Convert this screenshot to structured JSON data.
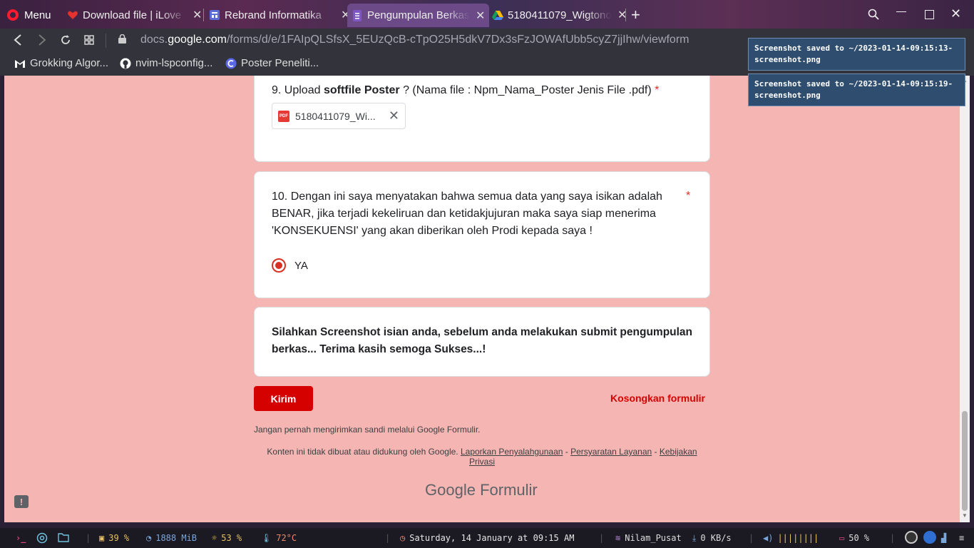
{
  "browser": {
    "menu_label": "Menu",
    "tabs": [
      {
        "title": "Download file | iLove",
        "icon": "heart-icon"
      },
      {
        "title": "Rebrand Informatika",
        "icon": "forms-icon"
      },
      {
        "title": "Pengumpulan Berkas",
        "icon": "forms-icon"
      },
      {
        "title": "5180411079_Wigtono",
        "icon": "drive-icon"
      }
    ],
    "url_prefix": "docs.",
    "url_host": "google.com",
    "url_path": "/forms/d/e/1FAIpQLSfsX_5EUzQcB-cTpO25H5dkV7Dx3sFzJOWAfUbb5cyZ7jjIhw/viewform",
    "bookmarks": [
      {
        "label": "Grokking Algor...",
        "icon": "gmail-icon"
      },
      {
        "label": "nvim-lspconfig...",
        "icon": "github-icon"
      },
      {
        "label": "Poster Peneliti...",
        "icon": "canva-icon"
      }
    ]
  },
  "notifications": [
    {
      "line1": "Screenshot saved to ~/2023-01-14-09:15:13-",
      "line2": "screenshot.png"
    },
    {
      "line1": "Screenshot saved to ~/2023-01-14-09:15:19-",
      "line2": "screenshot.png"
    }
  ],
  "form": {
    "q9": {
      "prefix": "9. Upload ",
      "bold": "softfile Poster",
      "suffix": " ? (Nama file : Npm_Nama_Poster Jenis File .pdf) ",
      "required_mark": "*",
      "file_name": "5180411079_Wi..."
    },
    "q10": {
      "line1": "10. Dengan ini saya menyatakan bahwa semua data yang saya isikan adalah",
      "line2": "BENAR, jika terjadi kekeliruan dan ketidakjujuran maka saya siap menerima",
      "line3": "'KONSEKUENSI' yang akan diberikan oleh Prodi kepada saya !",
      "required_mark": "*",
      "option_label": "YA",
      "option_selected": true
    },
    "info": {
      "line1": "Silahkan Screenshot isian anda, sebelum anda melakukan submit pengumpulan",
      "line2": "berkas... Terima kasih semoga Sukses...!"
    },
    "submit_label": "Kirim",
    "clear_label": "Kosongkan formulir",
    "password_note": "Jangan pernah mengirimkan sandi melalui Google Formulir.",
    "disclaimer_text": "Konten ini tidak dibuat atau didukung oleh Google.",
    "links": {
      "abuse": "Laporkan Penyalahgunaan",
      "terms": "Persyaratan Layanan",
      "privacy": "Kebijakan Privasi"
    },
    "footer_brand": "Google",
    "footer_product": "Formulir"
  },
  "statusbar": {
    "cpu": "39 %",
    "mem": "1888 MiB",
    "brightness": "53 %",
    "temp": "72°C",
    "datetime": "Saturday, 14 January at 09:15 AM",
    "wifi": "Nilam_Pusat",
    "net": "0 KB/s",
    "volume_bars": "||||||||",
    "battery": "50 %"
  },
  "colors": {
    "page_bg": "#f4b5b3",
    "accent": "#d50000",
    "notif_bg": "#2f4e6f"
  }
}
